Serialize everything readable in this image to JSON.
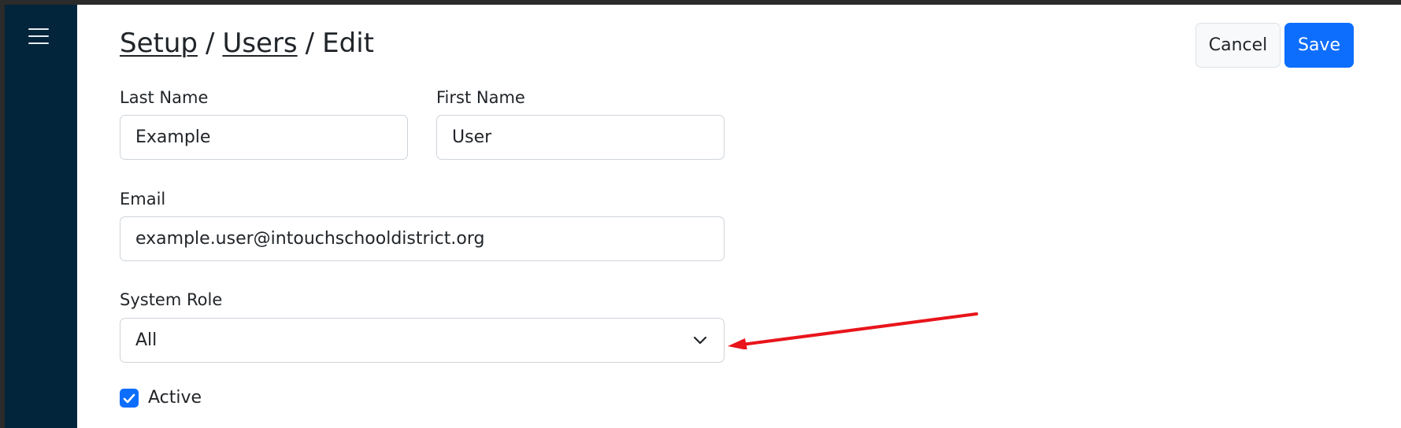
{
  "breadcrumb": {
    "items": [
      "Setup",
      "Users",
      "Edit"
    ],
    "separator": "/"
  },
  "toolbar": {
    "cancel_label": "Cancel",
    "save_label": "Save"
  },
  "form": {
    "last_name": {
      "label": "Last Name",
      "value": "Example"
    },
    "first_name": {
      "label": "First Name",
      "value": "User"
    },
    "email": {
      "label": "Email",
      "value": "example.user@intouchschooldistrict.org"
    },
    "system_role": {
      "label": "System Role",
      "value": "All"
    },
    "active": {
      "label": "Active",
      "checked": true
    }
  },
  "icons": {
    "menu": "hamburger-menu-icon",
    "select": "chevron-down-icon",
    "checkbox": "checkmark-icon",
    "annotation": "red-arrow-annotation"
  },
  "colors": {
    "sidebar": "#02253b",
    "primary": "#0d6efd",
    "annotation": "#e8151b"
  }
}
